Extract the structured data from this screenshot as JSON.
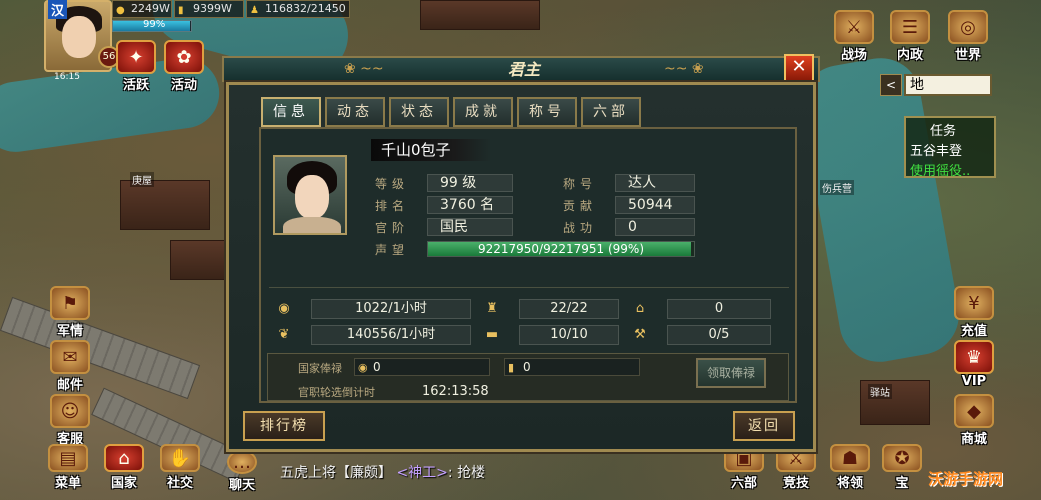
{
  "hud": {
    "kingdom": "汉",
    "level": "56",
    "time": "16:15",
    "hp_percent": "99%",
    "copper": "2249W",
    "grain": "9399W",
    "troops": "116832/21450",
    "location_placeholder": "地",
    "location_arrow": "<"
  },
  "left_menu": [
    {
      "label": "活跃"
    },
    {
      "label": "活动"
    },
    {
      "label": "军情"
    },
    {
      "label": "邮件"
    },
    {
      "label": "客服"
    }
  ],
  "top_right_menu": [
    {
      "label": "战场"
    },
    {
      "label": "内政"
    },
    {
      "label": "世界"
    }
  ],
  "right_menu": [
    {
      "label": "充值"
    },
    {
      "label": "VIP"
    },
    {
      "label": "商城"
    }
  ],
  "bottom_menu": [
    {
      "label": "菜单"
    },
    {
      "label": "国家"
    },
    {
      "label": "社交"
    },
    {
      "label": "聊天"
    },
    {
      "label": "六部"
    },
    {
      "label": "竞技"
    },
    {
      "label": "将领"
    },
    {
      "label": "宝"
    }
  ],
  "task_panel": {
    "title": "任务",
    "line1": "五谷丰登",
    "line2": "使用徭役.."
  },
  "map_labels": [
    "庚屋",
    "伤兵营",
    "驿站"
  ],
  "dialog": {
    "title": "君主",
    "close": "✕",
    "tabs": [
      "信息",
      "动态",
      "状态",
      "成就",
      "称号",
      "六部"
    ],
    "player_name": "千山0包子",
    "labels": {
      "level": "等级",
      "rank": "排名",
      "office": "官阶",
      "prestige": "声望",
      "title": "称号",
      "contribution": "贡献",
      "combat": "战功"
    },
    "values": {
      "level": "99 级",
      "rank": "3760 名",
      "office": "国民",
      "title": "达人",
      "contribution": "50944",
      "combat": "0",
      "prestige_text": "92217950/92217951 (99%)"
    },
    "resources": [
      "1022/1小时",
      "22/22",
      "0",
      "140556/1小时",
      "10/10",
      "0/5"
    ],
    "salary": {
      "national_label": "国家俸禄",
      "national_copper": "0",
      "national_grain": "0",
      "collect": "领取俸禄",
      "countdown_label": "官职轮选倒计时",
      "countdown": "162:13:58"
    },
    "leaderboard": "排行榜",
    "back": "返回"
  },
  "chat": {
    "prefix": "五虎上将",
    "bracket_name": "【廉颇】",
    "mid": "<神工>",
    "suffix": ": 抢楼"
  },
  "watermark": "沃游手游网"
}
